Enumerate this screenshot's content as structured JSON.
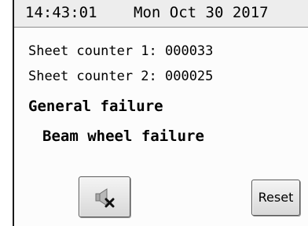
{
  "status_bar": {
    "time": "14:43:01",
    "date": "Mon Oct 30 2017"
  },
  "counters": {
    "sheet_counter_1": "Sheet counter 1: 000033",
    "sheet_counter_2": "Sheet counter 2: 000025"
  },
  "alarms": {
    "general": "General failure",
    "detail": "Beam wheel failure"
  },
  "buttons": {
    "mute_icon": "speaker-muted-icon",
    "reset_label": "Reset"
  },
  "colors": {
    "status_bar_bg": "#ededed",
    "button_bg": "#e6e6e6",
    "mute_x": "#111111"
  }
}
